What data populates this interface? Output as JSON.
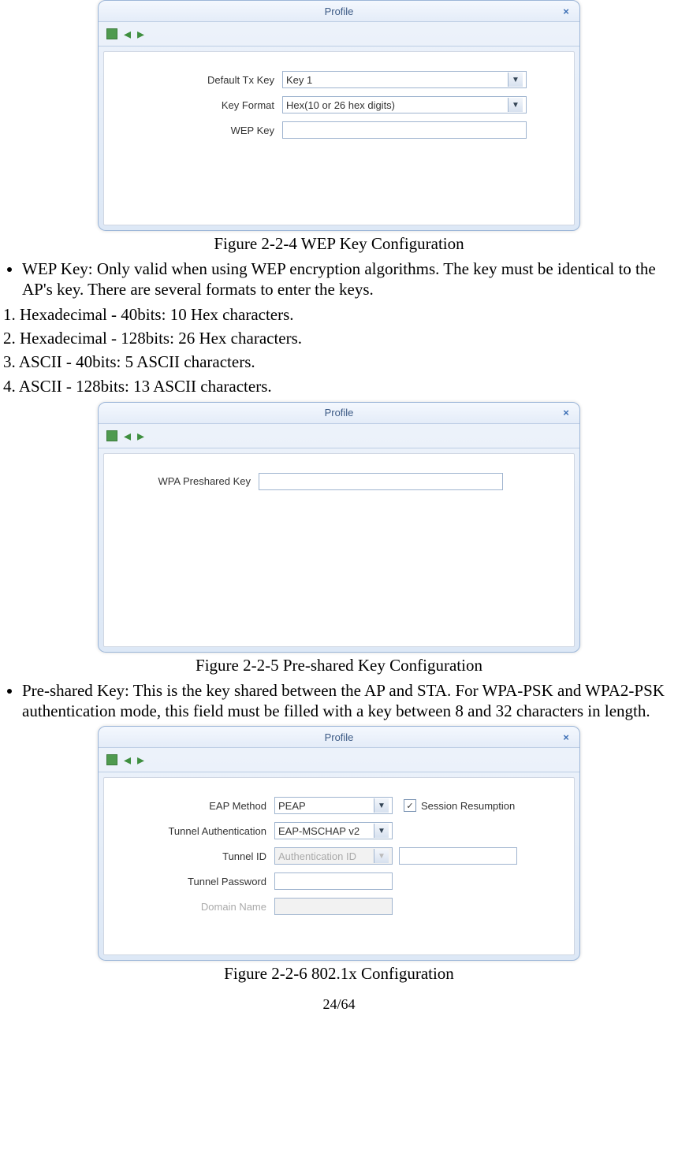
{
  "dialog1": {
    "title": "Profile",
    "fields": {
      "defaultTxKey": {
        "label": "Default Tx Key",
        "value": "Key 1"
      },
      "keyFormat": {
        "label": "Key Format",
        "value": "Hex(10 or 26 hex digits)"
      },
      "wepKey": {
        "label": "WEP Key",
        "value": ""
      }
    }
  },
  "caption1": "Figure 2-2-4 WEP Key Configuration",
  "bullet1": "WEP Key: Only valid when using WEP encryption algorithms. The key must be identical to the AP's key. There are several formats to enter the keys.",
  "numlist": {
    "n1": "1. Hexadecimal - 40bits: 10 Hex characters.",
    "n2": "2. Hexadecimal - 128bits: 26 Hex characters.",
    "n3": "3. ASCII - 40bits: 5 ASCII characters.",
    "n4": "4. ASCII - 128bits: 13 ASCII characters."
  },
  "dialog2": {
    "title": "Profile",
    "fields": {
      "psk": {
        "label": "WPA Preshared Key",
        "value": ""
      }
    }
  },
  "caption2": "Figure 2-2-5 Pre-shared Key Configuration",
  "bullet2": "Pre-shared Key: This is the key shared between the AP and STA. For WPA-PSK and WPA2-PSK authentication mode, this field must be filled with a key between 8 and 32 characters in length.",
  "dialog3": {
    "title": "Profile",
    "fields": {
      "eapMethod": {
        "label": "EAP Method",
        "value": "PEAP"
      },
      "session": {
        "label": "Session Resumption",
        "checked": true
      },
      "tunnelAuth": {
        "label": "Tunnel Authentication",
        "value": "EAP-MSCHAP v2"
      },
      "tunnelId": {
        "label": "Tunnel ID",
        "value": "Authentication ID",
        "idvalue": ""
      },
      "tunnelPwd": {
        "label": "Tunnel Password",
        "value": ""
      },
      "domain": {
        "label": "Domain Name",
        "value": ""
      }
    }
  },
  "caption3": "Figure 2-2-6 802.1x Configuration",
  "pagenum": "24/64"
}
